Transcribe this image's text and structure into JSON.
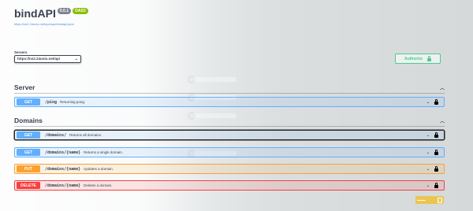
{
  "app": {
    "title": "bindAPI",
    "version_badge": "0.0.1",
    "oas_badge": "OAS3",
    "spec_url": "https://ns2.24unix.net/openapi/bindapi.json"
  },
  "servers": {
    "label": "Servers",
    "selected": "https://ns2.24unix.net/api"
  },
  "authorize": {
    "label": "Authorize"
  },
  "sections": [
    {
      "name": "Server",
      "operations": [
        {
          "method": "GET",
          "path": "/ping",
          "summary": "Returning pong."
        }
      ]
    },
    {
      "name": "Domains",
      "operations": [
        {
          "method": "GET",
          "path": "/domains/",
          "summary": "Returns all domains."
        },
        {
          "method": "GET",
          "path": "/domains/{name}",
          "summary": "Returns a single domain."
        },
        {
          "method": "PUT",
          "path": "/domains/{name}",
          "summary": "Updates a domain."
        },
        {
          "method": "DELETE",
          "path": "/domains/{name}",
          "summary": "Deletes a domain."
        }
      ]
    }
  ],
  "colors": {
    "get": "#61affe",
    "put": "#fca130",
    "delete": "#f93e3e",
    "authorize": "#49cc90"
  }
}
